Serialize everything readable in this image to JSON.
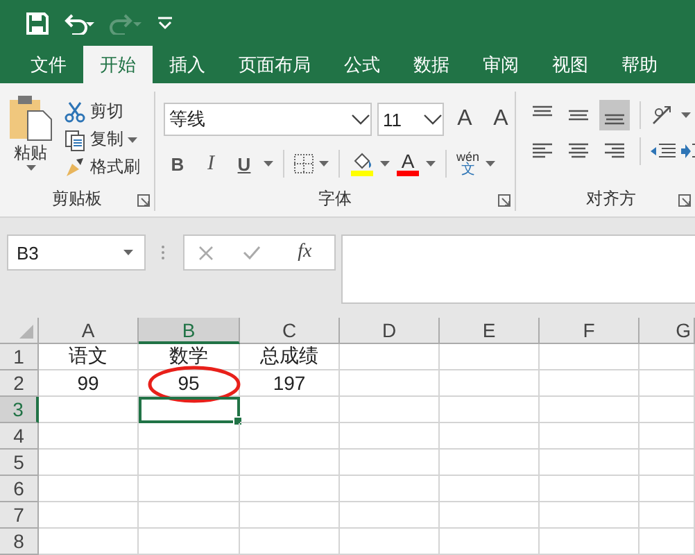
{
  "quick_access": [
    {
      "kind": "save",
      "disabled": false
    },
    {
      "kind": "undo",
      "disabled": false
    },
    {
      "kind": "redo",
      "disabled": true
    },
    {
      "kind": "customize",
      "disabled": false
    }
  ],
  "tabs": [
    {
      "label": "文件",
      "selected": false
    },
    {
      "label": "开始",
      "selected": true
    },
    {
      "label": "插入",
      "selected": false
    },
    {
      "label": "页面布局",
      "selected": false
    },
    {
      "label": "公式",
      "selected": false
    },
    {
      "label": "数据",
      "selected": false
    },
    {
      "label": "审阅",
      "selected": false
    },
    {
      "label": "视图",
      "selected": false
    },
    {
      "label": "帮助",
      "selected": false
    }
  ],
  "clipboard": {
    "label": "剪贴板",
    "paste": "粘贴",
    "cut": "剪切",
    "copy": "复制",
    "format_painter": "格式刷"
  },
  "font": {
    "label": "字体",
    "font_name": "等线",
    "font_size": "11",
    "grow": "A",
    "shrink": "A",
    "bold": "B",
    "italic": "I",
    "underline": "U",
    "phonetic_top": "wén",
    "phonetic_bottom": "文",
    "color_buttons": [
      {
        "kind": "fill",
        "color": "#ffff00"
      },
      {
        "kind": "text",
        "color": "#ff0000",
        "text": "A"
      }
    ]
  },
  "alignment": {
    "label": "对齐方",
    "vertical": [
      {
        "kind": "top",
        "selected": false
      },
      {
        "kind": "middle",
        "selected": false
      },
      {
        "kind": "bottom",
        "selected": true
      }
    ]
  },
  "formula_bar": {
    "name_box": "B3",
    "function": "fx"
  },
  "sheet": {
    "columns": [
      {
        "label": "A",
        "selected": false
      },
      {
        "label": "B",
        "selected": true
      },
      {
        "label": "C",
        "selected": false
      },
      {
        "label": "D",
        "selected": false
      },
      {
        "label": "E",
        "selected": false
      },
      {
        "label": "F",
        "selected": false
      },
      {
        "label": "G",
        "selected": false
      }
    ],
    "rows": [
      {
        "label": "1",
        "selected": false,
        "cells": [
          {
            "value": "语文",
            "circled": false
          },
          {
            "value": "数学",
            "circled": false
          },
          {
            "value": "总成绩",
            "circled": false
          }
        ]
      },
      {
        "label": "2",
        "selected": false,
        "cells": [
          {
            "value": "99",
            "circled": false
          },
          {
            "value": "95",
            "circled": true
          },
          {
            "value": "197",
            "circled": false
          }
        ]
      },
      {
        "label": "3",
        "selected": true
      },
      {
        "label": "4",
        "selected": false
      },
      {
        "label": "5",
        "selected": false
      },
      {
        "label": "6",
        "selected": false
      },
      {
        "label": "7",
        "selected": false
      },
      {
        "label": "8",
        "selected": false
      }
    ]
  }
}
